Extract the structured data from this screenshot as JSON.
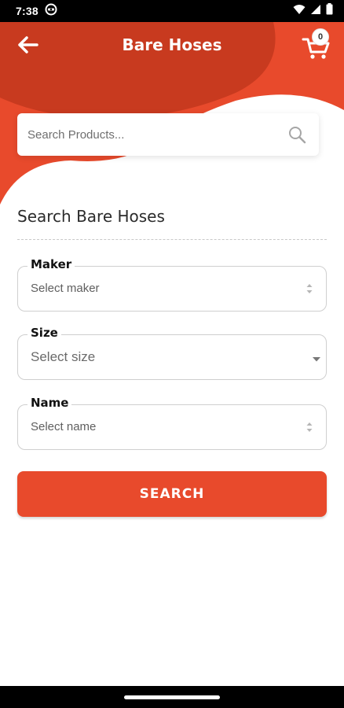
{
  "status_bar": {
    "time": "7:38",
    "icons": [
      "game-controller-icon",
      "wifi-icon",
      "cellular-signal-icon",
      "battery-icon"
    ]
  },
  "header": {
    "title": "Bare Hoses",
    "back_icon": "arrow-left-icon",
    "cart_icon": "shopping-cart-icon",
    "cart_count": "0",
    "colors": {
      "primary": "#e84a2c",
      "primary_dark": "#c83a1f"
    }
  },
  "search": {
    "placeholder": "Search Products...",
    "icon": "search-icon"
  },
  "main": {
    "section_title": "Search Bare Hoses",
    "fields": {
      "maker": {
        "label": "Maker",
        "value": "Select maker"
      },
      "size": {
        "label": "Size",
        "value": "Select size"
      },
      "name": {
        "label": "Name",
        "value": "Select name"
      }
    },
    "search_button_label": "SEARCH"
  }
}
